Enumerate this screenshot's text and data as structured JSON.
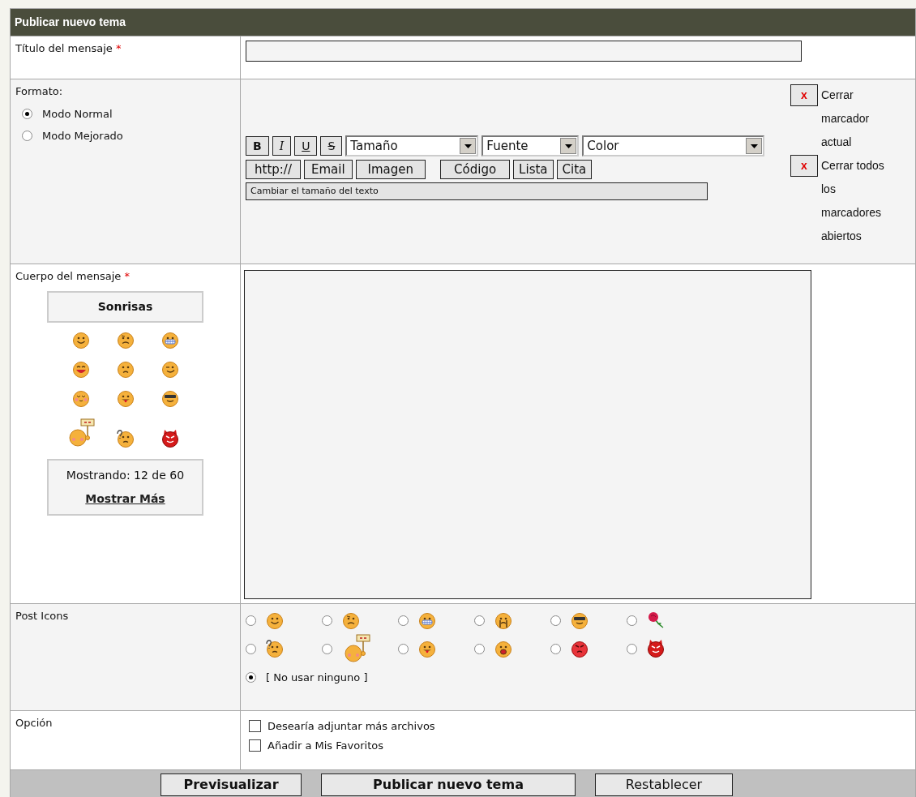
{
  "form": {
    "title": "Publicar nuevo tema"
  },
  "subject": {
    "label": "Título del mensaje",
    "required_mark": "*"
  },
  "format": {
    "label": "Formato:",
    "modes": [
      {
        "label": "Modo Normal",
        "selected": true
      },
      {
        "label": "Modo Mejorado",
        "selected": false
      }
    ]
  },
  "toolbar": {
    "style_buttons": [
      {
        "kind": "bold",
        "label": "B"
      },
      {
        "kind": "italic",
        "label": "I"
      },
      {
        "kind": "underline",
        "label": "U"
      },
      {
        "kind": "strike",
        "label": "S"
      }
    ],
    "selects": [
      "Tamaño",
      "Fuente",
      "Color"
    ],
    "tag_buttons": [
      "http://",
      "Email",
      "Imagen",
      "Código",
      "Lista",
      "Cita"
    ],
    "hint": "Cambiar el tamaño del texto"
  },
  "close_links": [
    {
      "symbol": "x",
      "label": "Cerrar marcador actual"
    },
    {
      "symbol": "x",
      "label": "Cerrar todos los marcadores abiertos"
    }
  ],
  "body": {
    "label": "Cuerpo del mensaje",
    "required_mark": "*"
  },
  "smilies": {
    "title": "Sonrisas",
    "items": [
      {
        "kind": "smile"
      },
      {
        "kind": "confused"
      },
      {
        "kind": "grin"
      },
      {
        "kind": "laugh"
      },
      {
        "kind": "sad"
      },
      {
        "kind": "wink"
      },
      {
        "kind": "blush"
      },
      {
        "kind": "tongue"
      },
      {
        "kind": "sunglasses"
      },
      {
        "kind": "sign"
      },
      {
        "kind": "question"
      },
      {
        "kind": "devil"
      }
    ],
    "count": "Mostrando: 12 de 60",
    "more": "Mostrar Más"
  },
  "post_icons": {
    "label": "Post Icons",
    "items": [
      {
        "kind": "smile",
        "selected": false
      },
      {
        "kind": "confused",
        "selected": false
      },
      {
        "kind": "grin",
        "selected": false
      },
      {
        "kind": "crying",
        "selected": false
      },
      {
        "kind": "sunglasses",
        "selected": false
      },
      {
        "kind": "rose",
        "selected": false
      },
      {
        "kind": "question",
        "selected": false
      },
      {
        "kind": "sign",
        "selected": false
      },
      {
        "kind": "tongue",
        "selected": false
      },
      {
        "kind": "shocked",
        "selected": false
      },
      {
        "kind": "angry",
        "selected": false
      },
      {
        "kind": "devil",
        "selected": false
      }
    ],
    "none": {
      "label": "[ No usar ninguno ]",
      "selected": true
    }
  },
  "options": {
    "label": "Opción",
    "items": [
      {
        "label": "Desearía adjuntar más archivos",
        "checked": false
      },
      {
        "label": "Añadir a Mis Favoritos",
        "checked": false
      }
    ]
  },
  "buttons": [
    {
      "label": "Previsualizar",
      "kind": "strong"
    },
    {
      "label": "Publicar nuevo tema",
      "kind": "strong"
    },
    {
      "label": "Restablecer",
      "kind": "plain"
    }
  ]
}
